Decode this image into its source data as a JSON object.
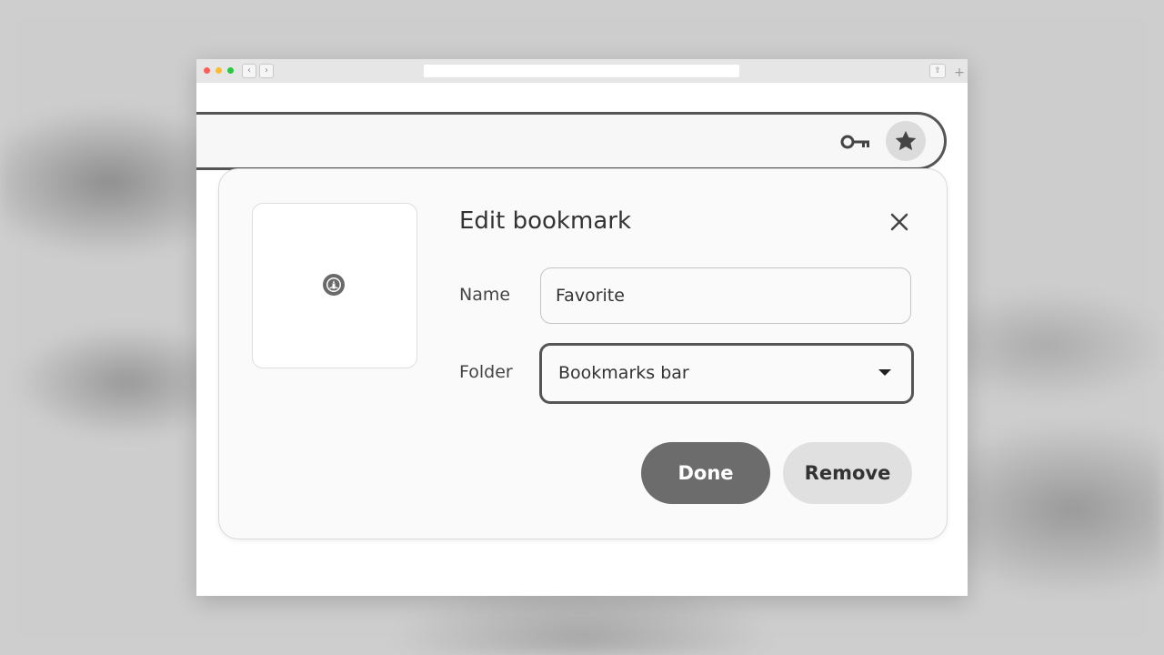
{
  "dialog": {
    "title": "Edit bookmark",
    "name_label": "Name",
    "name_value": "Favorite",
    "folder_label": "Folder",
    "folder_value": "Bookmarks bar",
    "done_label": "Done",
    "remove_label": "Remove"
  },
  "icons": {
    "key": "key-icon",
    "star": "star-icon",
    "close": "close-icon",
    "favicon": "starbucks-logo-icon",
    "dropdown": "caret-down-icon"
  },
  "colors": {
    "primary_button": "#6c6c6c",
    "secondary_button": "#e0e0e0",
    "focus_border": "#555555"
  }
}
